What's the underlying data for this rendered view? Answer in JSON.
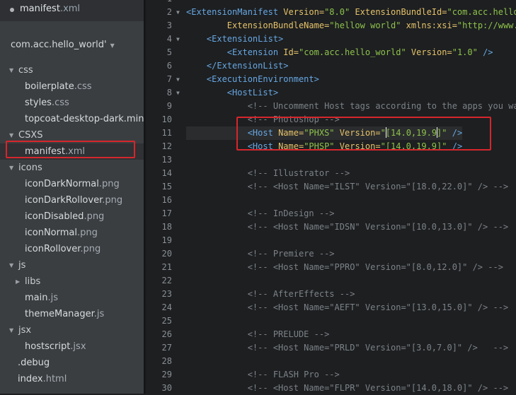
{
  "working_set": {
    "file_name": "manifest",
    "file_ext": ".xml"
  },
  "project": {
    "title": "com.acc.hello_world'",
    "caret": "▼"
  },
  "tree": [
    {
      "kind": "folder",
      "level": 0,
      "name": "css",
      "ext": "",
      "expanded": true
    },
    {
      "kind": "file",
      "level": 1,
      "name": "boilerplate",
      "ext": ".css"
    },
    {
      "kind": "file",
      "level": 1,
      "name": "styles",
      "ext": ".css"
    },
    {
      "kind": "file",
      "level": 1,
      "name": "topcoat-desktop-dark.min",
      "ext": ".css"
    },
    {
      "kind": "folder",
      "level": 0,
      "name": "CSXS",
      "ext": "",
      "expanded": true
    },
    {
      "kind": "file",
      "level": 1,
      "name": "manifest",
      "ext": ".xml",
      "selected": true
    },
    {
      "kind": "folder",
      "level": 0,
      "name": "icons",
      "ext": "",
      "expanded": true
    },
    {
      "kind": "file",
      "level": 1,
      "name": "iconDarkNormal",
      "ext": ".png"
    },
    {
      "kind": "file",
      "level": 1,
      "name": "iconDarkRollover",
      "ext": ".png"
    },
    {
      "kind": "file",
      "level": 1,
      "name": "iconDisabled",
      "ext": ".png"
    },
    {
      "kind": "file",
      "level": 1,
      "name": "iconNormal",
      "ext": ".png"
    },
    {
      "kind": "file",
      "level": 1,
      "name": "iconRollover",
      "ext": ".png"
    },
    {
      "kind": "folder",
      "level": 0,
      "name": "js",
      "ext": "",
      "expanded": true
    },
    {
      "kind": "folder",
      "level": 1,
      "name": "libs",
      "ext": "",
      "expanded": false
    },
    {
      "kind": "file",
      "level": 1,
      "name": "main",
      "ext": ".js"
    },
    {
      "kind": "file",
      "level": 1,
      "name": "themeManager",
      "ext": ".js"
    },
    {
      "kind": "folder",
      "level": 0,
      "name": "jsx",
      "ext": "",
      "expanded": true
    },
    {
      "kind": "file",
      "level": 1,
      "name": "hostscript",
      "ext": ".jsx"
    },
    {
      "kind": "file",
      "level": 0,
      "name": ".debug",
      "ext": ""
    },
    {
      "kind": "file",
      "level": 0,
      "name": "index",
      "ext": ".html"
    }
  ],
  "code_lines": [
    {
      "n": "1",
      "fold": "",
      "parts": []
    },
    {
      "n": "2",
      "fold": "▼",
      "parts": [
        [
          "tag",
          "<ExtensionManifest "
        ],
        [
          "attr",
          "Version="
        ],
        [
          "str",
          "\"8.0\" "
        ],
        [
          "attr",
          "ExtensionBundleId="
        ],
        [
          "str",
          "\"com.acc.hello"
        ]
      ]
    },
    {
      "n": "3",
      "fold": "",
      "parts": [
        [
          "punc",
          "        "
        ],
        [
          "attr",
          "ExtensionBundleName="
        ],
        [
          "str",
          "\"hellow world\" "
        ],
        [
          "attr",
          "xmlns:xsi="
        ],
        [
          "str",
          "\"http://www."
        ]
      ]
    },
    {
      "n": "4",
      "fold": "▼",
      "parts": [
        [
          "punc",
          "    "
        ],
        [
          "tag",
          "<ExtensionList>"
        ]
      ]
    },
    {
      "n": "5",
      "fold": "",
      "parts": [
        [
          "punc",
          "        "
        ],
        [
          "tag",
          "<Extension "
        ],
        [
          "attr",
          "Id="
        ],
        [
          "str",
          "\"com.acc.hello_world\" "
        ],
        [
          "attr",
          "Version="
        ],
        [
          "str",
          "\"1.0\" "
        ],
        [
          "tag",
          "/>"
        ]
      ]
    },
    {
      "n": "6",
      "fold": "",
      "parts": [
        [
          "punc",
          "    "
        ],
        [
          "tag",
          "</ExtensionList>"
        ]
      ]
    },
    {
      "n": "7",
      "fold": "▼",
      "parts": [
        [
          "punc",
          "    "
        ],
        [
          "tag",
          "<ExecutionEnvironment>"
        ]
      ]
    },
    {
      "n": "8",
      "fold": "▼",
      "parts": [
        [
          "punc",
          "        "
        ],
        [
          "tag",
          "<HostList>"
        ]
      ]
    },
    {
      "n": "9",
      "fold": "",
      "parts": [
        [
          "punc",
          "            "
        ],
        [
          "cmt",
          "<!-- Uncomment Host tags according to the apps you wa"
        ]
      ]
    },
    {
      "n": "10",
      "fold": "",
      "parts": [
        [
          "punc",
          "            "
        ],
        [
          "cmt",
          "<!-- Photoshop -->"
        ]
      ]
    },
    {
      "n": "11",
      "fold": "",
      "hl": true,
      "parts": [
        [
          "punc",
          "            "
        ],
        [
          "tag",
          "<Host "
        ],
        [
          "attr",
          "Name="
        ],
        [
          "str",
          "\"PHXS\" "
        ],
        [
          "attr",
          "Version="
        ],
        [
          "str",
          "\""
        ],
        [
          "cursor",
          ""
        ],
        [
          "str",
          "[14.0,19.9"
        ],
        [
          "cursor",
          ""
        ],
        [
          "str",
          "]\" "
        ],
        [
          "tag",
          "/>"
        ]
      ]
    },
    {
      "n": "12",
      "fold": "",
      "parts": [
        [
          "punc",
          "            "
        ],
        [
          "tag",
          "<Host "
        ],
        [
          "attr",
          "Name="
        ],
        [
          "str",
          "\"PHSP\" "
        ],
        [
          "attr",
          "Version="
        ],
        [
          "str",
          "\"[14.0,19.9]\" "
        ],
        [
          "tag",
          "/>"
        ]
      ]
    },
    {
      "n": "13",
      "fold": "",
      "parts": []
    },
    {
      "n": "14",
      "fold": "",
      "parts": [
        [
          "punc",
          "            "
        ],
        [
          "cmt",
          "<!-- Illustrator -->"
        ]
      ]
    },
    {
      "n": "15",
      "fold": "",
      "parts": [
        [
          "punc",
          "            "
        ],
        [
          "cmt",
          "<!-- <Host Name=\"ILST\" Version=\"[18.0,22.0]\" /> -->"
        ]
      ]
    },
    {
      "n": "16",
      "fold": "",
      "parts": []
    },
    {
      "n": "17",
      "fold": "",
      "parts": [
        [
          "punc",
          "            "
        ],
        [
          "cmt",
          "<!-- InDesign -->"
        ]
      ]
    },
    {
      "n": "18",
      "fold": "",
      "parts": [
        [
          "punc",
          "            "
        ],
        [
          "cmt",
          "<!-- <Host Name=\"IDSN\" Version=\"[10.0,13.0]\" /> -->"
        ]
      ]
    },
    {
      "n": "19",
      "fold": "",
      "parts": []
    },
    {
      "n": "20",
      "fold": "",
      "parts": [
        [
          "punc",
          "            "
        ],
        [
          "cmt",
          "<!-- Premiere -->"
        ]
      ]
    },
    {
      "n": "21",
      "fold": "",
      "parts": [
        [
          "punc",
          "            "
        ],
        [
          "cmt",
          "<!-- <Host Name=\"PPRO\" Version=\"[8.0,12.0]\" /> -->"
        ]
      ]
    },
    {
      "n": "22",
      "fold": "",
      "parts": []
    },
    {
      "n": "23",
      "fold": "",
      "parts": [
        [
          "punc",
          "            "
        ],
        [
          "cmt",
          "<!-- AfterEffects -->"
        ]
      ]
    },
    {
      "n": "24",
      "fold": "",
      "parts": [
        [
          "punc",
          "            "
        ],
        [
          "cmt",
          "<!-- <Host Name=\"AEFT\" Version=\"[13.0,15.0]\" /> -->"
        ]
      ]
    },
    {
      "n": "25",
      "fold": "",
      "parts": []
    },
    {
      "n": "26",
      "fold": "",
      "parts": [
        [
          "punc",
          "            "
        ],
        [
          "cmt",
          "<!-- PRELUDE -->"
        ]
      ]
    },
    {
      "n": "27",
      "fold": "",
      "parts": [
        [
          "punc",
          "            "
        ],
        [
          "cmt",
          "<!-- <Host Name=\"PRLD\" Version=\"[3.0,7.0]\" />   -->"
        ]
      ]
    },
    {
      "n": "28",
      "fold": "",
      "parts": []
    },
    {
      "n": "29",
      "fold": "",
      "parts": [
        [
          "punc",
          "            "
        ],
        [
          "cmt",
          "<!-- FLASH Pro -->"
        ]
      ]
    },
    {
      "n": "30",
      "fold": "",
      "parts": [
        [
          "punc",
          "            "
        ],
        [
          "cmt",
          "<!-- <Host Name=\"FLPR\" Version=\"[14.0,18.0]\" /> -->"
        ]
      ]
    }
  ],
  "colors": {
    "highlight_box": "#d6262c",
    "tag": "#68a7e2",
    "attribute": "#e6c36a",
    "string": "#8fc24b",
    "comment": "#7d8287"
  }
}
